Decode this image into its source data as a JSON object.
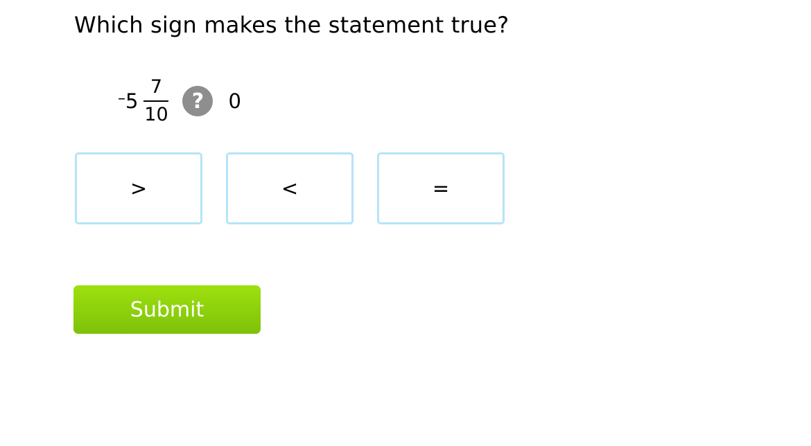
{
  "question": {
    "text": "Which sign makes the statement true?"
  },
  "statement": {
    "sign": "–",
    "whole": "5",
    "numerator": "7",
    "denominator": "10",
    "unknown_symbol": "?",
    "right_side": "0"
  },
  "options": [
    {
      "label": ">"
    },
    {
      "label": "<"
    },
    {
      "label": "="
    }
  ],
  "submit": {
    "label": "Submit"
  },
  "colors": {
    "option_border": "#b5e4f8",
    "unknown_bg": "#8e8e8e",
    "submit_top": "#9ee00e",
    "submit_bottom": "#7dc20a"
  }
}
